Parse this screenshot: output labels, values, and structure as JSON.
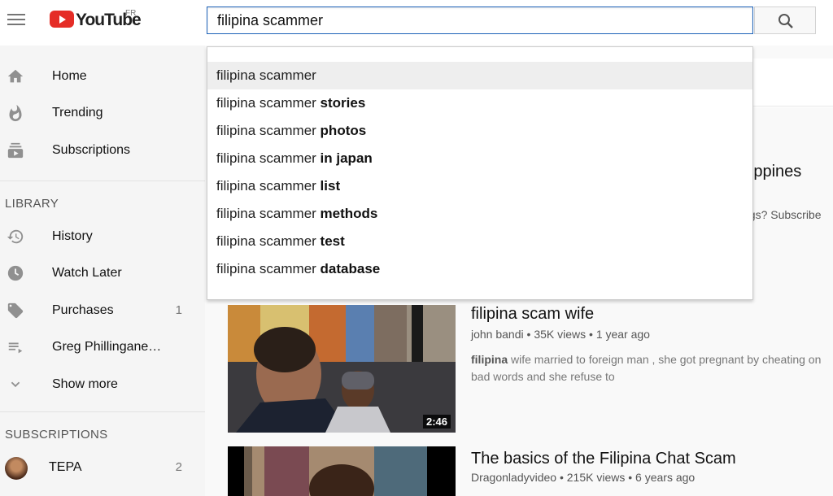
{
  "header": {
    "logo_text": "YouTube",
    "country": "FR",
    "search_value": "filipina scammer"
  },
  "suggestions": [
    {
      "base": "filipina scammer",
      "bold": ""
    },
    {
      "base": "filipina scammer ",
      "bold": "stories"
    },
    {
      "base": "filipina scammer ",
      "bold": "photos"
    },
    {
      "base": "filipina scammer ",
      "bold": "in japan"
    },
    {
      "base": "filipina scammer ",
      "bold": "list"
    },
    {
      "base": "filipina scammer ",
      "bold": "methods"
    },
    {
      "base": "filipina scammer ",
      "bold": "test"
    },
    {
      "base": "filipina scammer ",
      "bold": "database"
    }
  ],
  "sidebar": {
    "main": [
      {
        "label": "Home",
        "icon": "home-icon"
      },
      {
        "label": "Trending",
        "icon": "flame-icon"
      },
      {
        "label": "Subscriptions",
        "icon": "subscriptions-icon"
      }
    ],
    "library_heading": "LIBRARY",
    "library": [
      {
        "label": "History",
        "icon": "history-icon",
        "count": ""
      },
      {
        "label": "Watch Later",
        "icon": "clock-icon",
        "count": ""
      },
      {
        "label": "Purchases",
        "icon": "tag-icon",
        "count": "1"
      },
      {
        "label": "Greg Phillingane…",
        "icon": "playlist-icon",
        "count": ""
      },
      {
        "label": "Show more",
        "icon": "chevron-down-icon",
        "count": ""
      }
    ],
    "subscriptions_heading": "SUBSCRIPTIONS",
    "subscriptions": [
      {
        "label": "TEPA",
        "count": "2"
      }
    ]
  },
  "results_partial": {
    "title_fragment": "ilippines",
    "sub_fragment": "ags? Subscribe"
  },
  "videos": [
    {
      "title": "filipina scam wife",
      "channel": "john bandi",
      "views": "35K views",
      "age": "1 year ago",
      "desc_bold": "filipina",
      "desc": " wife married to foreign man , she got pregnant by cheating on bad words and she refuse to",
      "duration": "2:46"
    },
    {
      "title": "The basics of the Filipina Chat Scam",
      "channel": "Dragonladyvideo",
      "views": "215K views",
      "age": "6 years ago"
    }
  ]
}
